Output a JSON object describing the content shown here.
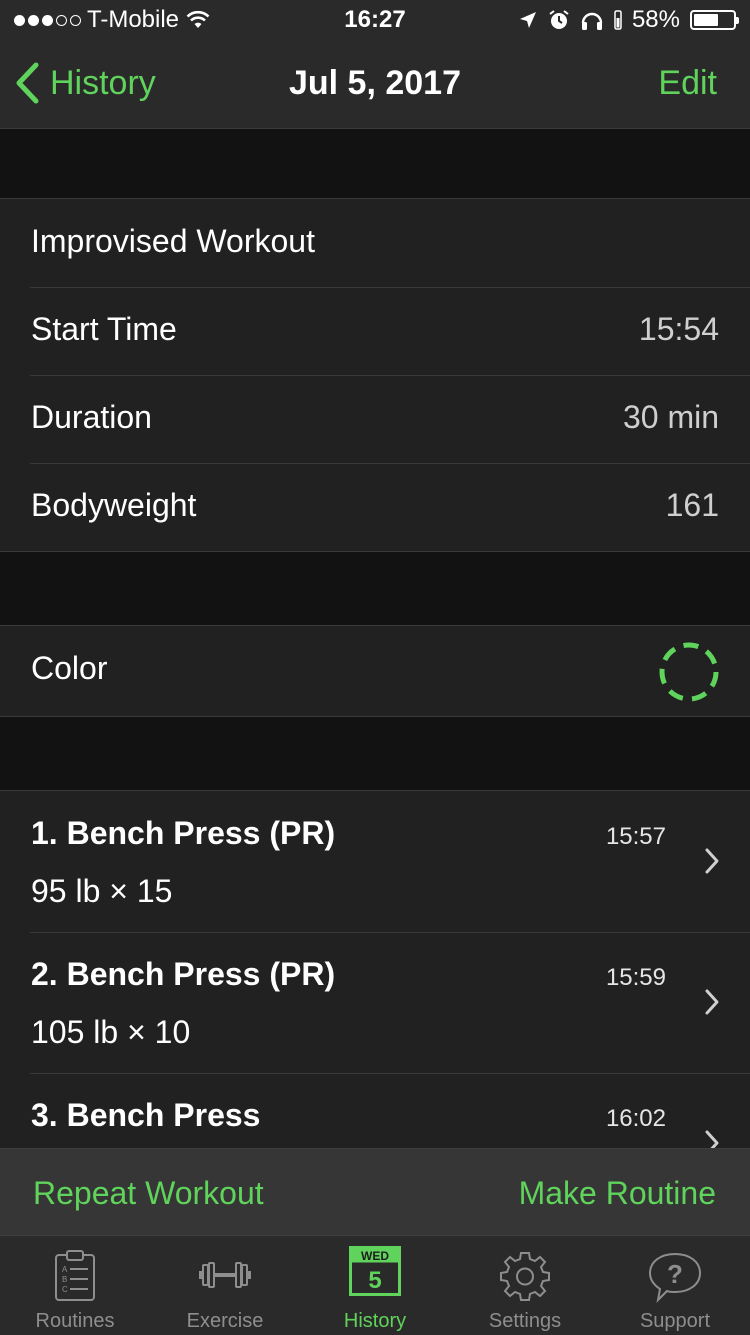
{
  "status_bar": {
    "carrier": "T-Mobile",
    "signal_bars_filled": 3,
    "signal_bars_total": 5,
    "time": "16:27",
    "battery": "58%",
    "battery_level": 0.58
  },
  "nav": {
    "back_label": "History",
    "title": "Jul 5, 2017",
    "edit_label": "Edit"
  },
  "workout": {
    "name": "Improvised Workout",
    "rows": [
      {
        "label": "Start Time",
        "value": "15:54"
      },
      {
        "label": "Duration",
        "value": "30 min"
      },
      {
        "label": "Bodyweight",
        "value": "161"
      }
    ]
  },
  "color_row": {
    "label": "Color",
    "color": "#5fd35b"
  },
  "exercises": [
    {
      "name": "1. Bench Press (PR)",
      "detail": "95 lb × 15",
      "time": "15:57"
    },
    {
      "name": "2. Bench Press (PR)",
      "detail": "105 lb × 10",
      "time": "15:59"
    },
    {
      "name": "3. Bench Press",
      "detail": "",
      "time": "16:02"
    }
  ],
  "actions": {
    "repeat_label": "Repeat Workout",
    "make_routine_label": "Make Routine"
  },
  "tabs": [
    {
      "label": "Routines",
      "icon": "clipboard-icon",
      "active": false
    },
    {
      "label": "Exercise",
      "icon": "dumbbell-icon",
      "active": false
    },
    {
      "label": "History",
      "icon": "calendar-icon",
      "active": true,
      "calendar_day": "WED",
      "calendar_date": "5"
    },
    {
      "label": "Settings",
      "icon": "gear-icon",
      "active": false
    },
    {
      "label": "Support",
      "icon": "help-bubble-icon",
      "active": false
    }
  ],
  "colors": {
    "accent": "#5fd35b",
    "background": "#121212",
    "cell": "#212121",
    "bar": "#2a2a2a"
  }
}
